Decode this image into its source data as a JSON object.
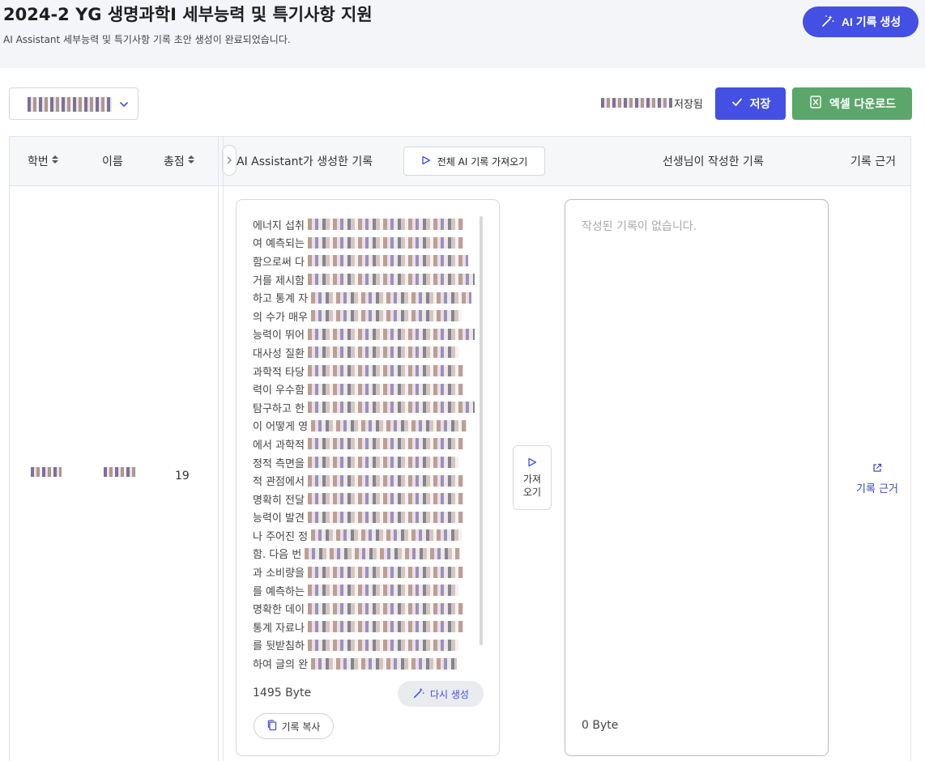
{
  "header": {
    "title": "2024-2 YG 생명과학I 세부능력 및 특기사항 지원",
    "subtitle": "AI Assistant 세부능력 및 특기사항 기록 초안 생성이 완료되었습니다.",
    "ai_generate_label": "AI 기록 생성"
  },
  "toolbar": {
    "saved_label": "저장됨",
    "save_label": "저장",
    "excel_label": "엑셀 다운로드"
  },
  "table": {
    "columns": {
      "student_id": "학번",
      "name": "이름",
      "score": "총점",
      "ai_record": "AI Assistant가 생성한 기록",
      "fetch_all": "전체 AI 기록 가져오기",
      "teacher_record": "선생님이 작성한 기록",
      "evidence": "기록 근거"
    },
    "rows": [
      {
        "score": "19",
        "ai_lines": [
          "에너지 섭취",
          "여 예측되는",
          "함으로써 다",
          "거를 제시함",
          "하고 통계 자",
          "의 수가 매우",
          "능력이 뛰어",
          "대사성 질환",
          "과학적 타당",
          "력이 우수함",
          "탐구하고 한",
          "이 어떻게 영",
          "에서 과학적",
          "정적 측면을",
          "적 관점에서",
          "명확히 전달",
          "능력이 발견",
          "나 주어진 정",
          "함. 다음 번",
          "과 소비량을",
          "를 예측하는",
          "명확한 데이",
          "통계 자료나",
          "를 뒷받침하",
          "하여 글의 완"
        ],
        "ai_byte": "1495 Byte",
        "regenerate_label": "다시 생성",
        "copy_label": "기록 복사",
        "fetch_label": "가져오기",
        "teacher_placeholder": "작성된 기록이 없습니다.",
        "teacher_byte": "0 Byte",
        "evidence_label": "기록 근거"
      }
    ]
  }
}
